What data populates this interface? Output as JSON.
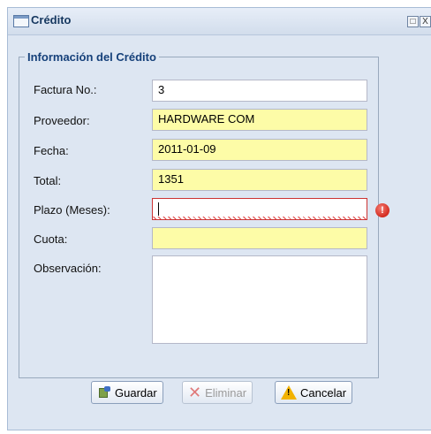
{
  "window": {
    "title": "Crédito",
    "restore_glyph": "□",
    "close_glyph": "X"
  },
  "form": {
    "legend": "Información del Crédito",
    "fields": [
      {
        "label": "Factura No.:",
        "value": "3"
      },
      {
        "label": "Proveedor:",
        "value": "HARDWARE COM"
      },
      {
        "label": "Fecha:",
        "value": "2011-01-09"
      },
      {
        "label": "Total:",
        "value": "1351"
      },
      {
        "label": "Plazo (Meses):",
        "value": ""
      },
      {
        "label": "Cuota:",
        "value": ""
      },
      {
        "label": "Observación:",
        "value": ""
      }
    ],
    "error_glyph": "!"
  },
  "buttons": {
    "save": "Guardar",
    "delete": "Eliminar",
    "cancel": "Cancelar"
  },
  "colors": {
    "required_field": "#fdfca7",
    "invalid_border": "#cc3333",
    "panel_bg": "#dde6f2",
    "legend_text": "#15407a"
  }
}
